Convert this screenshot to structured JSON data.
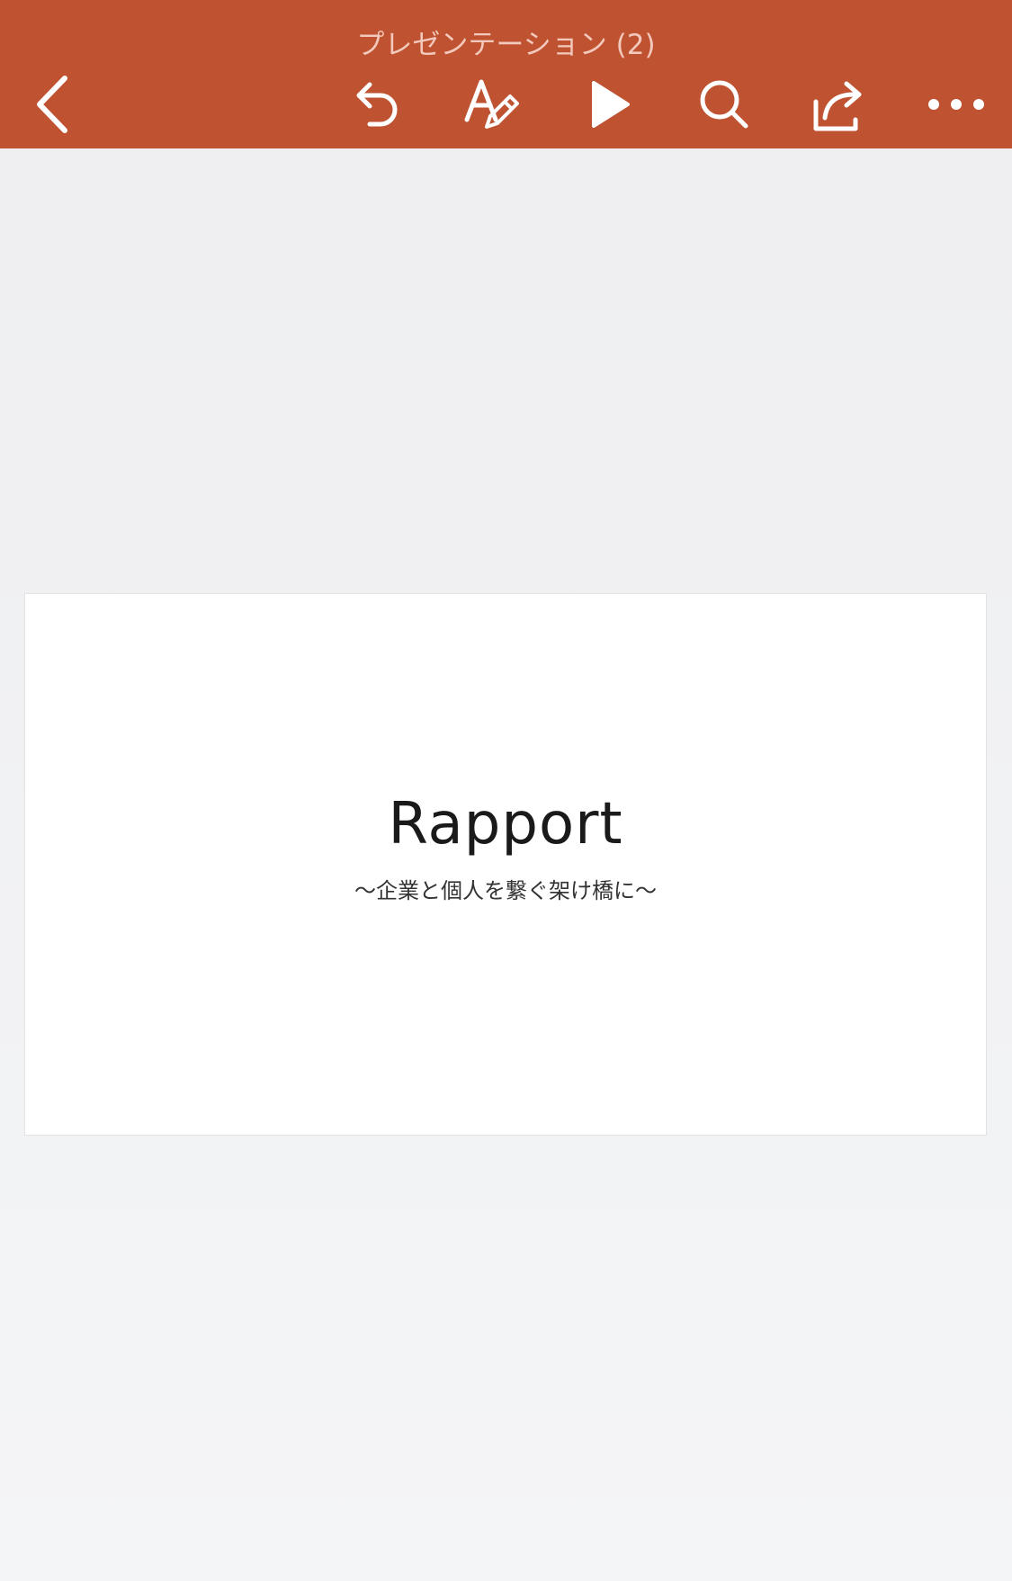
{
  "toolbar": {
    "title": "プレゼンテーション (2)",
    "background_color": "#bf5230",
    "buttons": [
      {
        "name": "back",
        "icon": "chevron-left-icon"
      },
      {
        "name": "undo",
        "icon": "undo-icon"
      },
      {
        "name": "edit",
        "icon": "text-edit-icon"
      },
      {
        "name": "play",
        "icon": "play-icon"
      },
      {
        "name": "search",
        "icon": "search-icon"
      },
      {
        "name": "share",
        "icon": "share-icon"
      },
      {
        "name": "more",
        "icon": "more-icon"
      }
    ]
  },
  "slide": {
    "title": "Rapport",
    "subtitle": "〜企業と個人を繋ぐ架け橋に〜"
  }
}
